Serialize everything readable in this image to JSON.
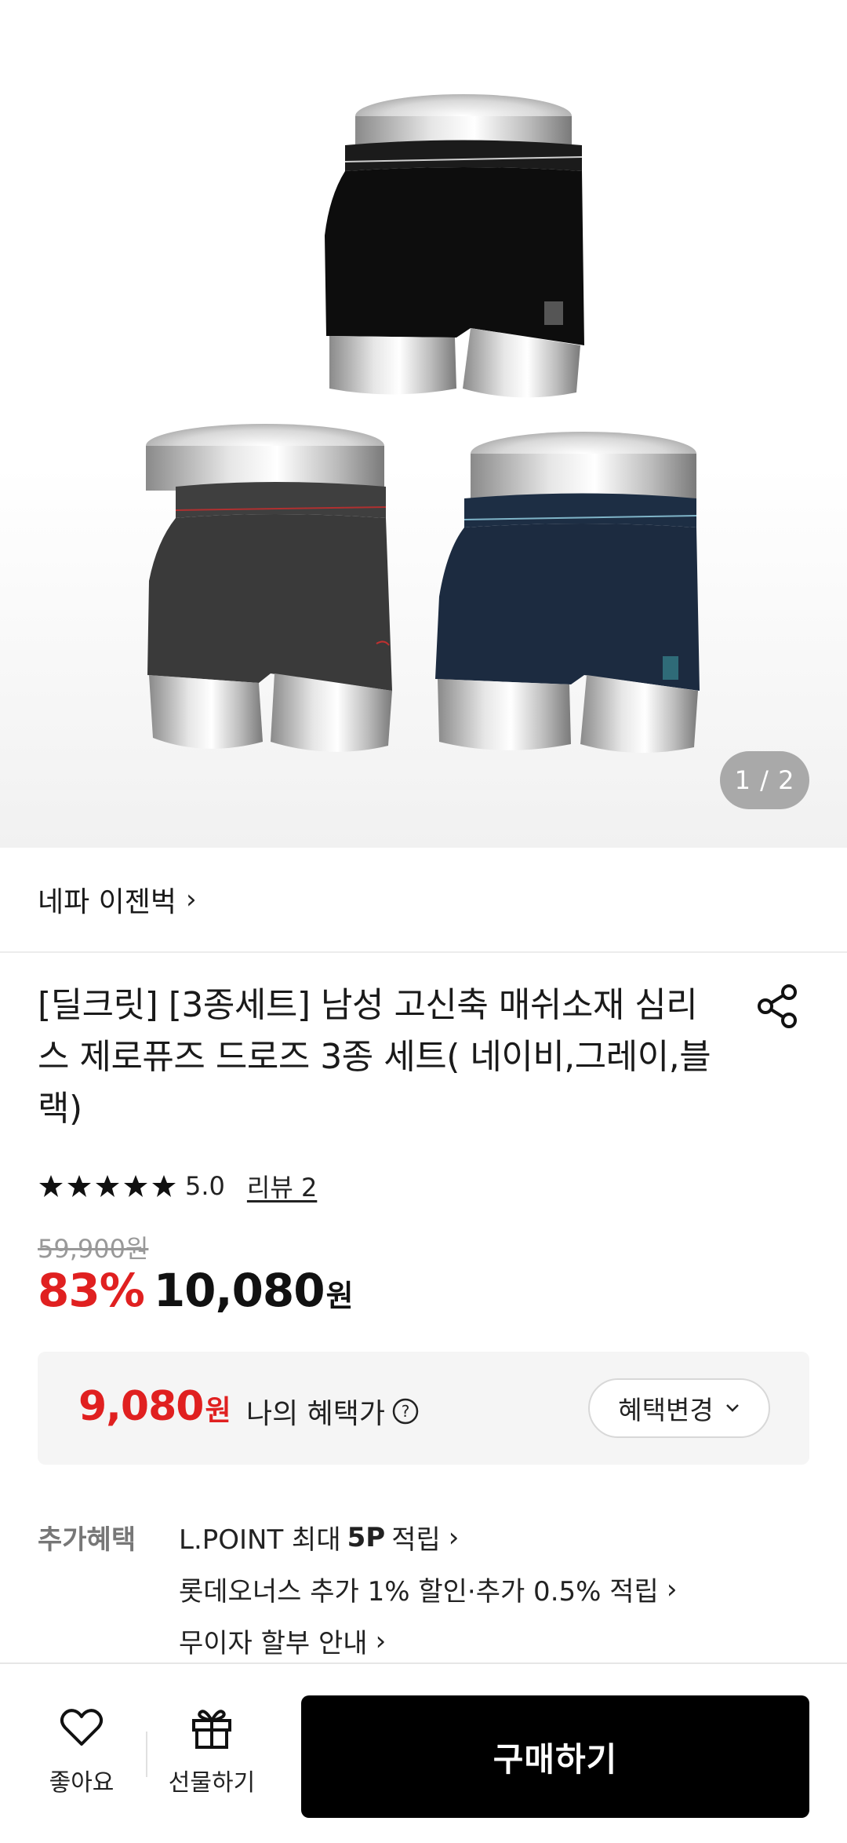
{
  "gallery": {
    "counter": "1 / 2"
  },
  "brand": {
    "name": "네파 이젠벅",
    "chevron": "›"
  },
  "product": {
    "title": "[딜크릿] [3종세트] 남성 고신축 매쉬소재 심리스 제로퓨즈 드로즈 3종 세트( 네이비,그레이,블랙)",
    "rating_score": "5.0",
    "rating_stars": 5,
    "review_link": "리뷰 2",
    "original_price": "59,900원",
    "discount": "83%",
    "price": "10,080",
    "currency": "원"
  },
  "benefit": {
    "price": "9,080",
    "currency": "원",
    "label": "나의 혜택가",
    "change_button": "혜택변경"
  },
  "extra_benefits": {
    "label": "추가혜택",
    "items": [
      {
        "prefix": "L.POINT 최대",
        "highlight": "5P",
        "suffix": "적립"
      },
      {
        "text": "롯데오너스 추가 1% 할인·추가 0.5% 적립"
      },
      {
        "text": "무이자 할부 안내"
      }
    ]
  },
  "bottom_bar": {
    "like_label": "좋아요",
    "gift_label": "선물하기",
    "buy_label": "구매하기"
  },
  "colors": {
    "accent_red": "#e02020",
    "buy_button": "#000000"
  },
  "icons": {
    "share": "share-icon",
    "help": "help-circle-icon",
    "like": "heart-icon",
    "gift": "gift-icon",
    "star": "star-icon"
  }
}
